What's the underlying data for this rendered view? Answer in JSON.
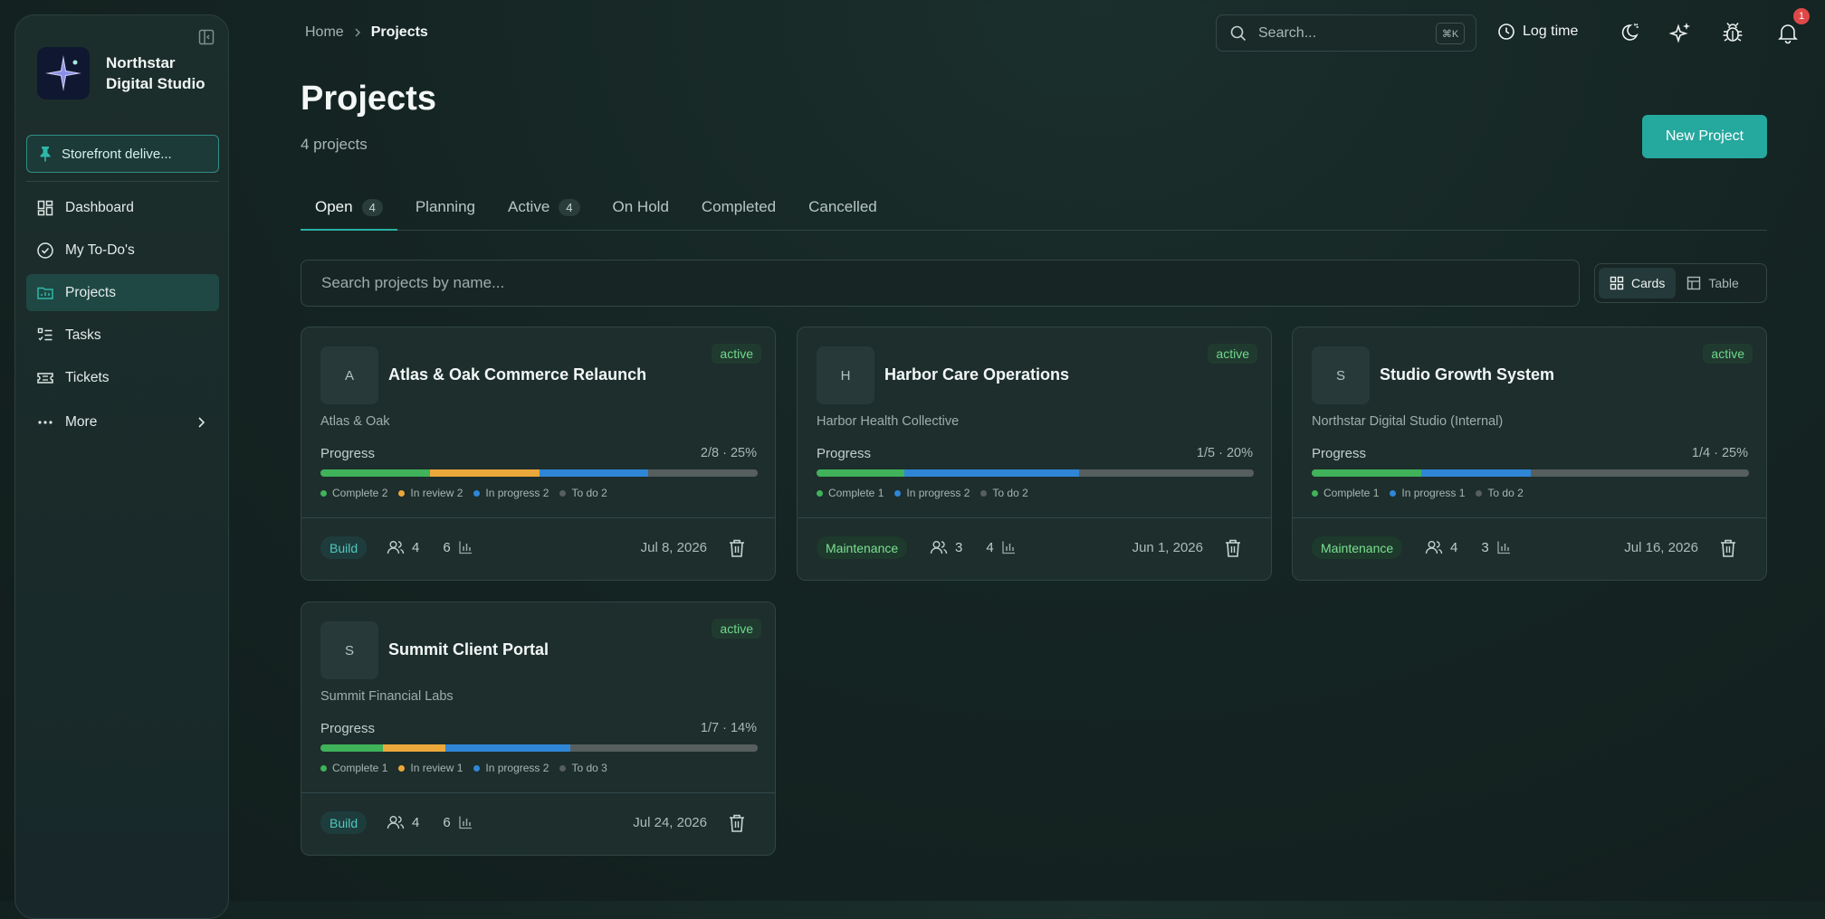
{
  "sidebar": {
    "brand_line1": "Northstar",
    "brand_line2": "Digital Studio",
    "pinned": "Storefront delive...",
    "items": [
      {
        "label": "Dashboard",
        "icon": "dashboard-icon"
      },
      {
        "label": "My To-Do's",
        "icon": "check-circle-icon"
      },
      {
        "label": "Projects",
        "icon": "folder-icon",
        "active": true
      },
      {
        "label": "Tasks",
        "icon": "checklist-icon"
      },
      {
        "label": "Tickets",
        "icon": "ticket-icon"
      }
    ],
    "more_label": "More"
  },
  "header": {
    "breadcrumb_home": "Home",
    "breadcrumb_current": "Projects",
    "search_placeholder": "Search...",
    "search_shortcut": "⌘K",
    "log_time": "Log time",
    "notification_count": "1"
  },
  "page": {
    "title": "Projects",
    "subtitle": "4 projects",
    "new_button": "New Project"
  },
  "tabs": [
    {
      "label": "Open",
      "count": "4",
      "active": true
    },
    {
      "label": "Planning",
      "count": ""
    },
    {
      "label": "Active",
      "count": "4"
    },
    {
      "label": "On Hold",
      "count": ""
    },
    {
      "label": "Completed",
      "count": ""
    },
    {
      "label": "Cancelled",
      "count": ""
    }
  ],
  "filter": {
    "placeholder": "Search projects by name..."
  },
  "view_toggle": {
    "cards": "Cards",
    "table": "Table",
    "selected": "Cards"
  },
  "colors": {
    "complete": "#3fb25a",
    "review": "#eba83a",
    "progress": "#2f86d6",
    "todo": "#565f5e",
    "accent": "#25a89e"
  },
  "projects": [
    {
      "initial": "A",
      "title": "Atlas & Oak Commerce Relaunch",
      "status": "active",
      "client": "Atlas & Oak",
      "progress_label": "Progress",
      "progress_value": "2/8 · 25%",
      "counts": {
        "complete": 2,
        "review": 2,
        "progress": 2,
        "todo": 2
      },
      "legend": [
        "Complete 2",
        "In review 2",
        "In progress 2",
        "To do 2"
      ],
      "type": "Build",
      "members": "4",
      "tasks": "6",
      "date": "Jul 8, 2026"
    },
    {
      "initial": "H",
      "title": "Harbor Care Operations",
      "status": "active",
      "client": "Harbor Health Collective",
      "progress_label": "Progress",
      "progress_value": "1/5 · 20%",
      "counts": {
        "complete": 1,
        "review": 0,
        "progress": 2,
        "todo": 2
      },
      "legend": [
        "Complete 1",
        "In progress 2",
        "To do 2"
      ],
      "type": "Maintenance",
      "members": "3",
      "tasks": "4",
      "date": "Jun 1, 2026"
    },
    {
      "initial": "S",
      "title": "Studio Growth System",
      "status": "active",
      "client": "Northstar Digital Studio (Internal)",
      "progress_label": "Progress",
      "progress_value": "1/4 · 25%",
      "counts": {
        "complete": 1,
        "review": 0,
        "progress": 1,
        "todo": 2
      },
      "legend": [
        "Complete 1",
        "In progress 1",
        "To do 2"
      ],
      "type": "Maintenance",
      "members": "4",
      "tasks": "3",
      "date": "Jul 16, 2026"
    },
    {
      "initial": "S",
      "title": "Summit Client Portal",
      "status": "active",
      "client": "Summit Financial Labs",
      "progress_label": "Progress",
      "progress_value": "1/7 · 14%",
      "counts": {
        "complete": 1,
        "review": 1,
        "progress": 2,
        "todo": 3
      },
      "legend": [
        "Complete 1",
        "In review 1",
        "In progress 2",
        "To do 3"
      ],
      "type": "Build",
      "members": "4",
      "tasks": "6",
      "date": "Jul 24, 2026"
    }
  ]
}
